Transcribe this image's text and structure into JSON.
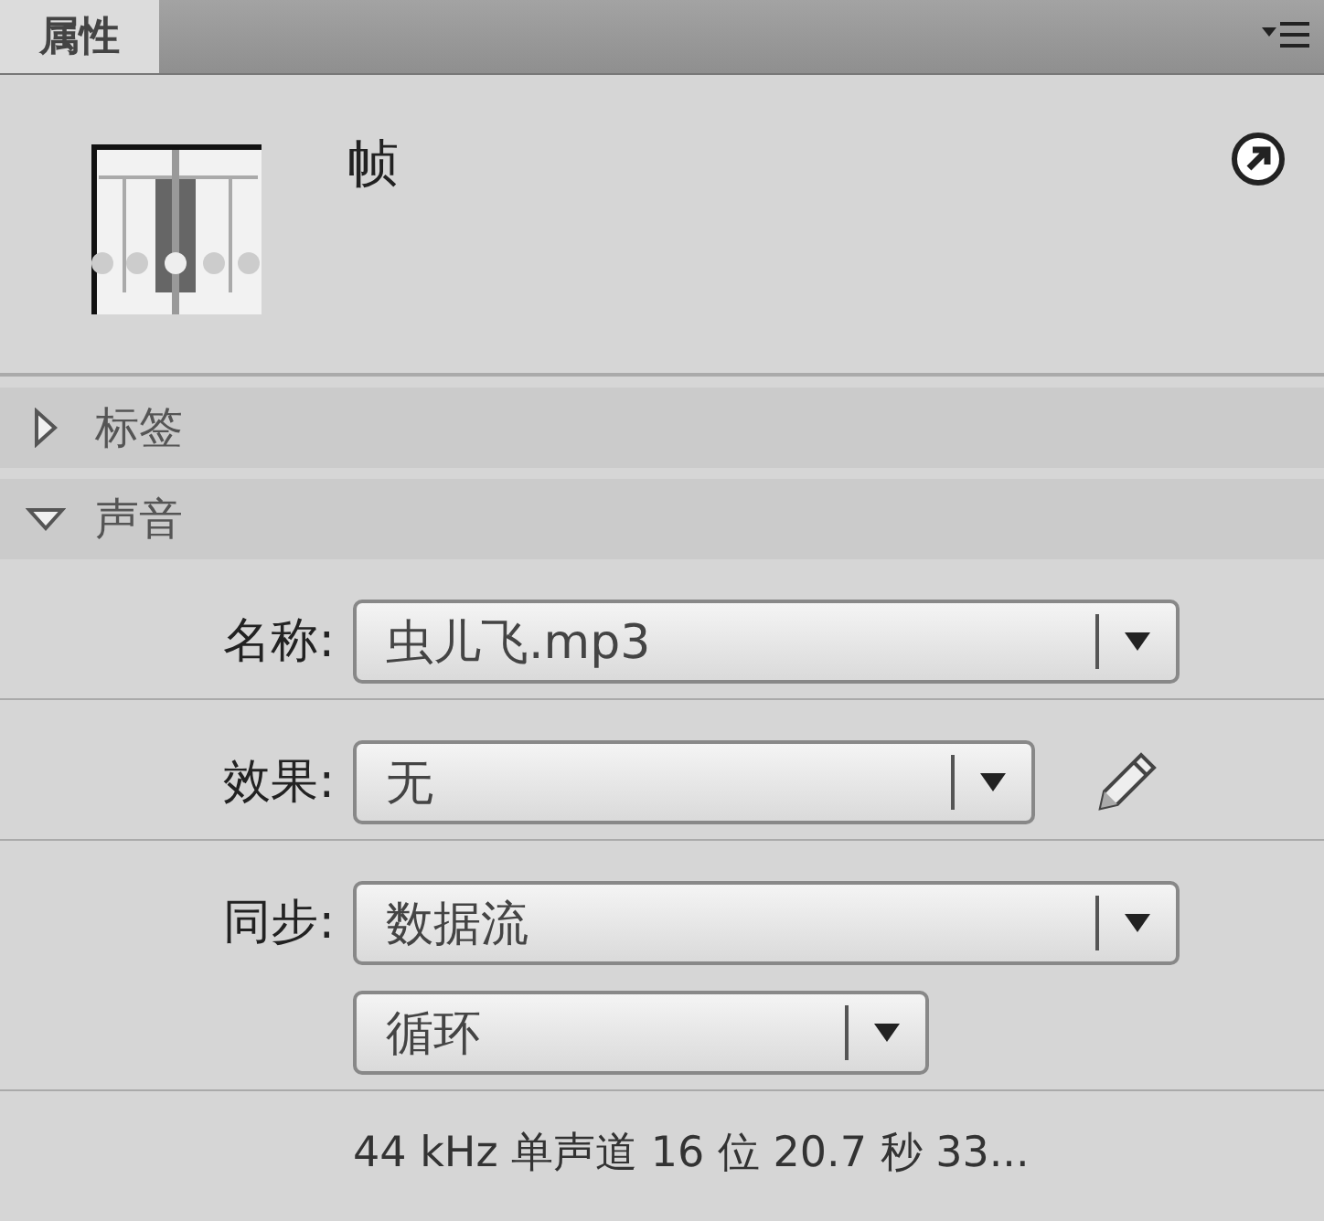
{
  "tabs": [
    {
      "label": "属性",
      "selected": true
    }
  ],
  "header": {
    "title": "帧"
  },
  "sections": [
    {
      "label": "标签",
      "expanded": false
    },
    {
      "label": "声音",
      "expanded": true
    }
  ],
  "sound": {
    "rows": [
      {
        "label": "名称:",
        "dropdowns": [
          {
            "value": "虫儿飞.mp3"
          }
        ],
        "edit_button": false
      },
      {
        "label": "效果:",
        "dropdowns": [
          {
            "value": "无"
          }
        ],
        "edit_button": true
      },
      {
        "label": "同步:",
        "dropdowns": [
          {
            "value": "数据流"
          },
          {
            "value": "循环"
          }
        ],
        "edit_button": false
      }
    ],
    "info": "44 kHz 单声道 16 位 20.7 秒 33..."
  }
}
